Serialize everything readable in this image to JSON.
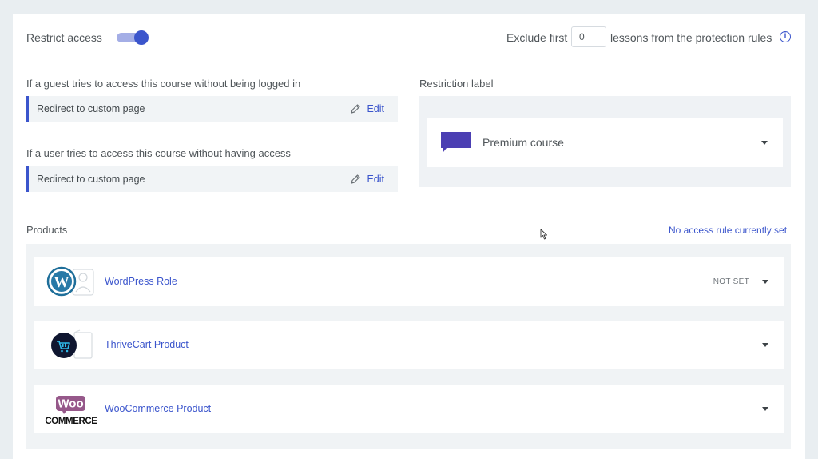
{
  "header": {
    "restrict_label": "Restrict access",
    "restrict_enabled": true,
    "exclude_prefix": "Exclude first",
    "exclude_value": "0",
    "exclude_suffix": "lessons from the protection rules"
  },
  "guest_rule": {
    "question": "If a guest tries to access this course without being logged in",
    "action": "Redirect to custom page",
    "edit_label": "Edit"
  },
  "user_rule": {
    "question": "If a user tries to access this course without having access",
    "action": "Redirect to custom page",
    "edit_label": "Edit"
  },
  "restriction_label": {
    "title": "Restriction label",
    "selected": "Premium course",
    "color": "#4b3fb3"
  },
  "products": {
    "title": "Products",
    "status_link": "No access rule currently set",
    "items": [
      {
        "name": "WordPress Role",
        "status": "NOT SET",
        "icon": "wordpress-icon"
      },
      {
        "name": "ThriveCart Product",
        "status": "",
        "icon": "thrivecart-icon"
      },
      {
        "name": "WooCommerce Product",
        "status": "",
        "icon": "woocommerce-icon",
        "logo_line1": "Woo",
        "logo_line2": "COMMERCE"
      }
    ]
  },
  "colors": {
    "accent": "#3b55cc",
    "woo_purple": "#96588a"
  }
}
